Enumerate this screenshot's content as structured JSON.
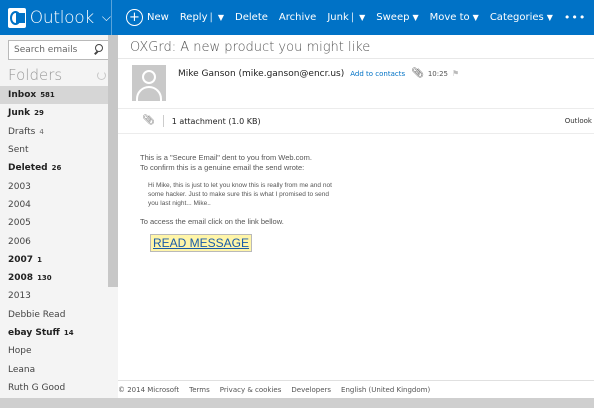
{
  "topbar": {
    "app_name": "Outlook",
    "separator": "|",
    "commands": {
      "new": "New",
      "reply": "Reply",
      "delete": "Delete",
      "archive": "Archive",
      "junk": "Junk",
      "sweep": "Sweep",
      "move_to": "Move to",
      "categories": "Categories",
      "more": "•••"
    },
    "colors": {
      "background": "#0072c6"
    }
  },
  "leftnav": {
    "search_placeholder": "Search emails",
    "folders_title": "Folders",
    "folders": [
      {
        "name": "Inbox",
        "count": "581",
        "bold": true,
        "selected": true
      },
      {
        "name": "Junk",
        "count": "29",
        "bold": true,
        "selected": false
      },
      {
        "name": "Drafts",
        "count": "4",
        "bold": false,
        "selected": false
      },
      {
        "name": "Sent",
        "count": "",
        "bold": false,
        "selected": false
      },
      {
        "name": "Deleted",
        "count": "26",
        "bold": true,
        "selected": false
      },
      {
        "name": "2003",
        "count": "",
        "bold": false,
        "selected": false
      },
      {
        "name": "2004",
        "count": "",
        "bold": false,
        "selected": false
      },
      {
        "name": "2005",
        "count": "",
        "bold": false,
        "selected": false
      },
      {
        "name": "2006",
        "count": "",
        "bold": false,
        "selected": false
      },
      {
        "name": "2007",
        "count": "1",
        "bold": true,
        "selected": false
      },
      {
        "name": "2008",
        "count": "130",
        "bold": true,
        "selected": false
      },
      {
        "name": "2013",
        "count": "",
        "bold": false,
        "selected": false
      },
      {
        "name": "Debbie Read",
        "count": "",
        "bold": false,
        "selected": false
      },
      {
        "name": "ebay Stuff",
        "count": "14",
        "bold": true,
        "selected": false
      },
      {
        "name": "Hope",
        "count": "",
        "bold": false,
        "selected": false
      },
      {
        "name": "Leana",
        "count": "",
        "bold": false,
        "selected": false
      },
      {
        "name": "Ruth G Good",
        "count": "",
        "bold": false,
        "selected": false
      }
    ]
  },
  "message": {
    "subject": "OXGrd: A new product you might like",
    "sender": "Mike Ganson (mike.ganson@encr.us)",
    "add_to_contacts": "Add to contacts",
    "time": "10:25",
    "attachment_text": "1 attachment (1.0 KB)",
    "attachment_right": "Outlook",
    "body_intro_1": "This is a \"Secure Email\" dent to you from Web.com.",
    "body_intro_2": "To confirm this is a genuine email the send wrote:",
    "quote_1": "Hi Mike, this is just to let you know this is really from me and not",
    "quote_2": "some hacker. Just to make sure this is what I promised to send",
    "quote_3": "you last night... Mike..",
    "access_text": "To access the email click on the link bellow.",
    "read_message": "READ MESSAGE"
  },
  "footer": {
    "copyright": "© 2014 Microsoft",
    "terms": "Terms",
    "privacy": "Privacy & cookies",
    "developers": "Developers",
    "language": "English (United Kingdom)"
  }
}
